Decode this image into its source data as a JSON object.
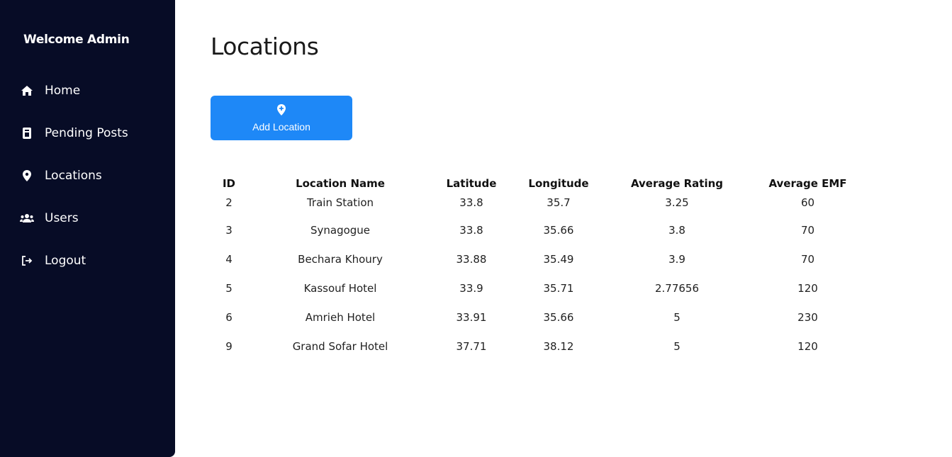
{
  "sidebar": {
    "welcome": "Welcome Admin",
    "items": [
      {
        "label": "Home",
        "icon": "home-icon"
      },
      {
        "label": "Pending Posts",
        "icon": "clipboard-icon"
      },
      {
        "label": "Locations",
        "icon": "location-pin-icon"
      },
      {
        "label": "Users",
        "icon": "users-icon"
      },
      {
        "label": "Logout",
        "icon": "logout-icon"
      }
    ]
  },
  "main": {
    "title": "Locations",
    "add_button": {
      "label": "Add Location",
      "icon": "location-plus-icon",
      "color": "#1e88f7"
    }
  },
  "table": {
    "headers": [
      "ID",
      "Location Name",
      "Latitude",
      "Longitude",
      "Average Rating",
      "Average EMF"
    ],
    "rows": [
      [
        "2",
        "Train Station",
        "33.8",
        "35.7",
        "3.25",
        "60"
      ],
      [
        "3",
        "Synagogue",
        "33.8",
        "35.66",
        "3.8",
        "70"
      ],
      [
        "4",
        "Bechara Khoury",
        "33.88",
        "35.49",
        "3.9",
        "70"
      ],
      [
        "5",
        "Kassouf Hotel",
        "33.9",
        "35.71",
        "2.77656",
        "120"
      ],
      [
        "6",
        "Amrieh Hotel",
        "33.91",
        "35.66",
        "5",
        "230"
      ],
      [
        "9",
        "Grand Sofar Hotel",
        "37.71",
        "38.12",
        "5",
        "120"
      ]
    ]
  },
  "colors": {
    "sidebar_bg": "#070c26",
    "accent": "#1e88f7"
  }
}
